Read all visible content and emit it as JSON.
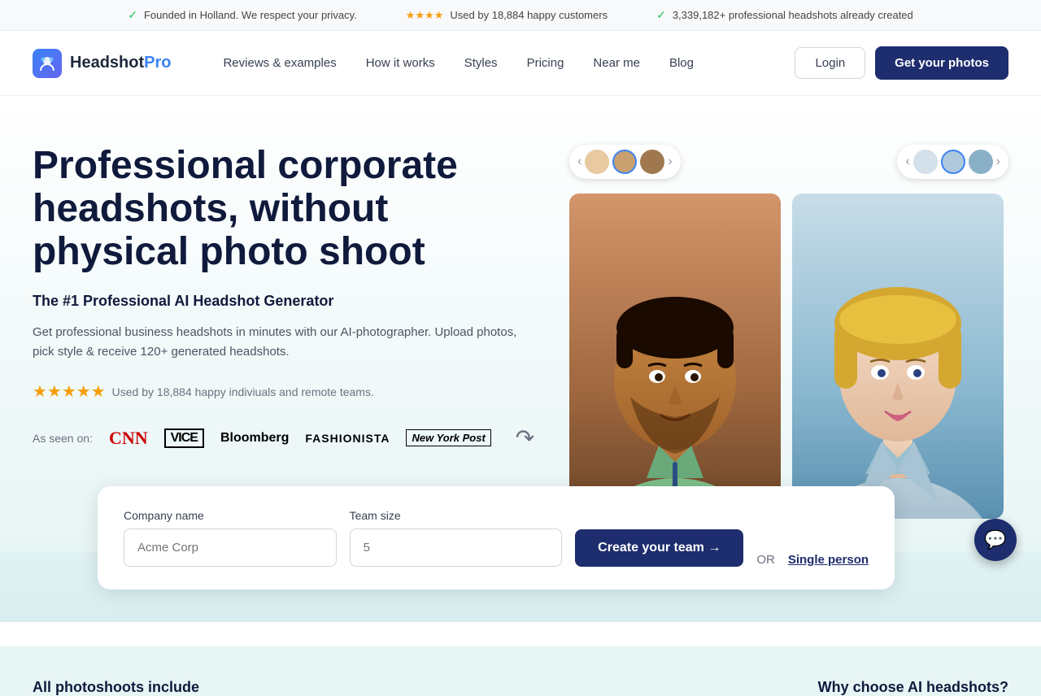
{
  "topBanner": {
    "items": [
      {
        "icon": "check",
        "text": "Founded in Holland. We respect your privacy."
      },
      {
        "stars": "★★★★",
        "text": "Used by 18,884 happy customers"
      },
      {
        "icon": "check",
        "text": "3,339,182+ professional headshots already created"
      }
    ]
  },
  "nav": {
    "logoText": "HeadshotPro",
    "links": [
      {
        "label": "Reviews & examples",
        "id": "reviews"
      },
      {
        "label": "How it works",
        "id": "how-it-works"
      },
      {
        "label": "Styles",
        "id": "styles"
      },
      {
        "label": "Pricing",
        "id": "pricing"
      },
      {
        "label": "Near me",
        "id": "near-me"
      },
      {
        "label": "Blog",
        "id": "blog"
      }
    ],
    "loginLabel": "Login",
    "ctaLabel": "Get your photos"
  },
  "hero": {
    "title": "Professional corporate headshots, without physical photo shoot",
    "subtitle": "The #1 Professional AI Headshot Generator",
    "description": "Get professional business headshots in minutes with our AI-photographer. Upload photos, pick style & receive 120+ generated headshots.",
    "ratingText": "Used by 18,884 happy indiviuals and remote teams.",
    "seenOnLabel": "As seen on:"
  },
  "form": {
    "companyLabel": "Company name",
    "companyPlaceholder": "Acme Corp",
    "teamSizeLabel": "Team size",
    "teamSizePlaceholder": "5",
    "createTeamBtn": "Create your team →",
    "orText": "OR",
    "singlePersonText": "Single person"
  },
  "bottomSection": {
    "leftTitle": "All photoshoots include",
    "rightTitle": "Why choose AI headshots?"
  },
  "chat": {
    "icon": "💬"
  }
}
